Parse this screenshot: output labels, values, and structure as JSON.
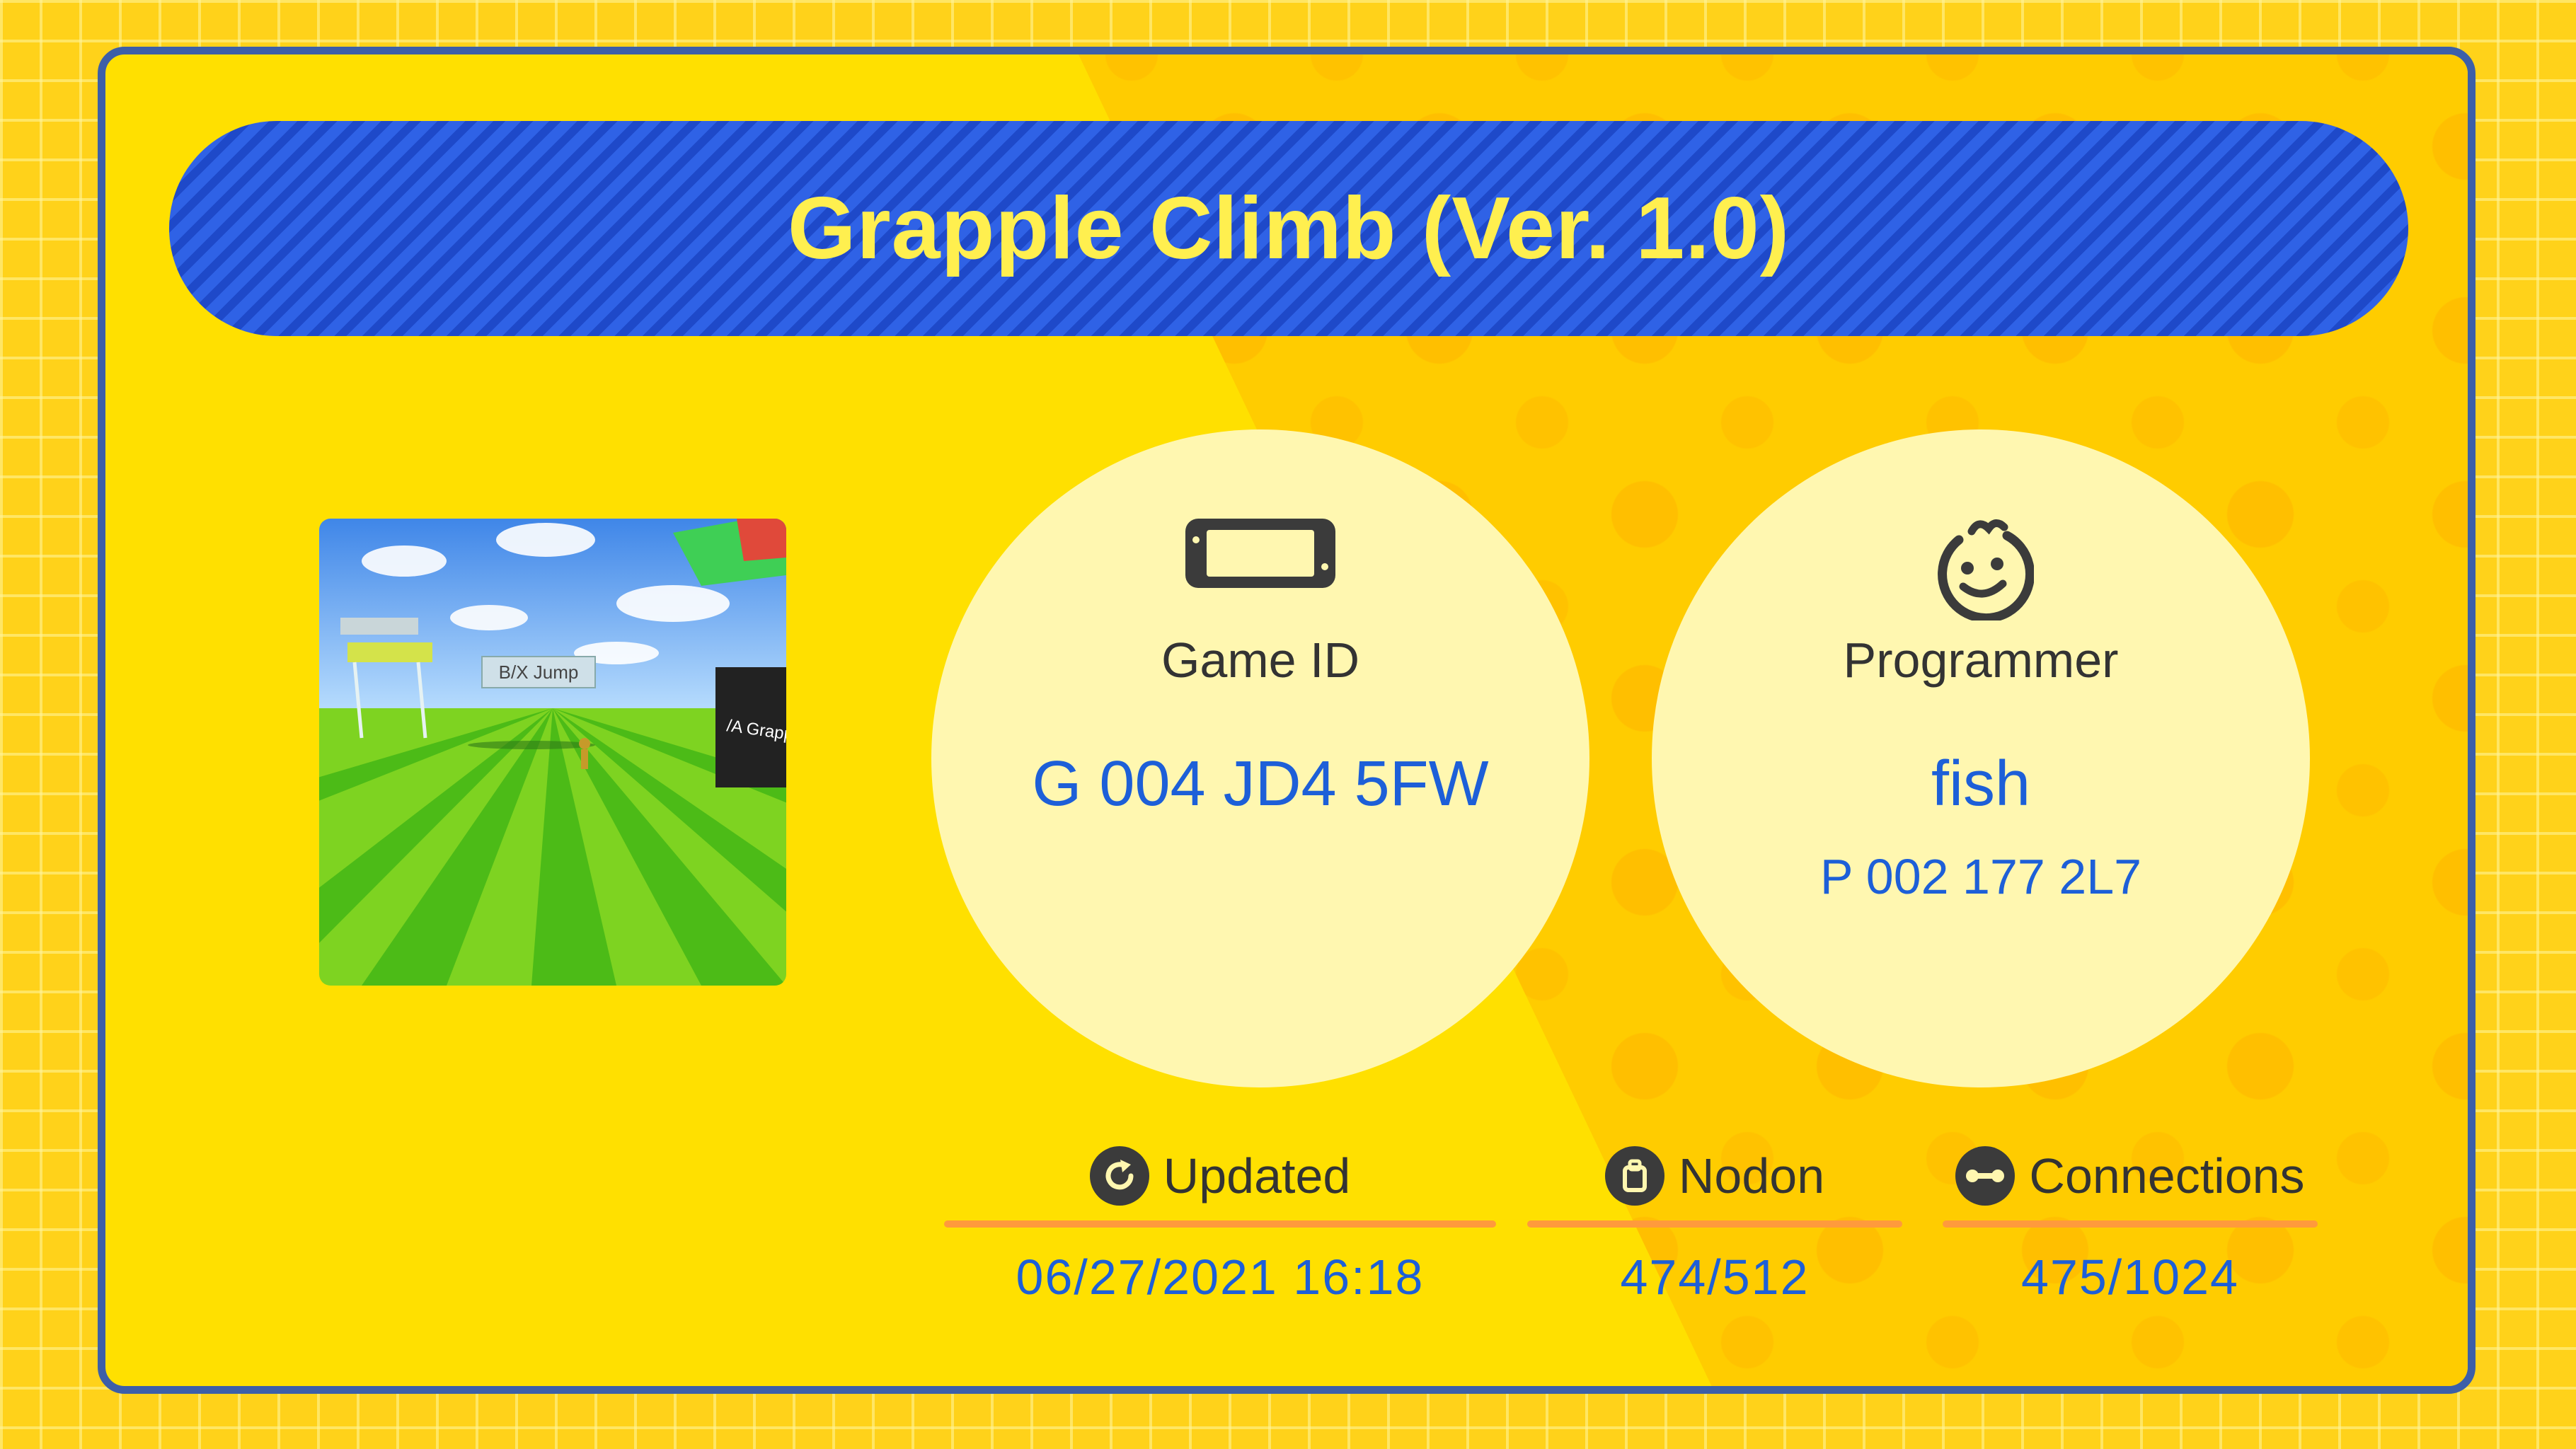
{
  "game": {
    "title": "Grapple Climb (Ver. 1.0)",
    "thumbnail_labels": {
      "jump": "B/X Jump",
      "grapple": "/A Grapp"
    }
  },
  "game_id": {
    "label": "Game ID",
    "value": "G 004 JD4 5FW",
    "icon": "console-icon"
  },
  "programmer": {
    "label": "Programmer",
    "name": "fish",
    "id": "P 002 177 2L7",
    "icon": "smiling-face-icon"
  },
  "stats": {
    "updated": {
      "label": "Updated",
      "value": "06/27/2021 16:18",
      "icon": "refresh-icon"
    },
    "nodon": {
      "label": "Nodon",
      "value": "474/512",
      "icon": "nodon-icon"
    },
    "connections": {
      "label": "Connections",
      "value": "475/1024",
      "icon": "connection-icon"
    }
  },
  "colors": {
    "banner": "#2f62e6",
    "title_text": "#ffef4f",
    "value_text": "#1d5fd8",
    "accent_line": "#ff9a3c",
    "card_border": "#3d5fa8"
  }
}
